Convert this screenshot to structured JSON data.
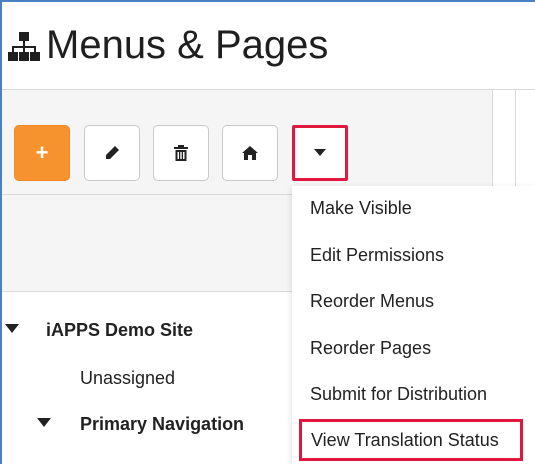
{
  "header": {
    "title": "Menus & Pages",
    "icon": "sitemap-icon"
  },
  "toolbar": {
    "add_label": "+",
    "buttons": [
      {
        "name": "add-button",
        "icon": "plus-icon",
        "color": "#f7932f"
      },
      {
        "name": "edit-button",
        "icon": "pencil-icon"
      },
      {
        "name": "delete-button",
        "icon": "trash-icon"
      },
      {
        "name": "home-button",
        "icon": "home-icon"
      },
      {
        "name": "more-actions-dropdown-button",
        "icon": "caret-down-icon",
        "highlight": "#e0173e"
      }
    ]
  },
  "dropdown": {
    "items": [
      {
        "label": "Make Visible"
      },
      {
        "label": "Edit Permissions"
      },
      {
        "label": "Reorder Menus"
      },
      {
        "label": "Reorder Pages"
      },
      {
        "label": "Submit for Distribution"
      },
      {
        "label": "View Translation Status",
        "highlighted": true
      }
    ]
  },
  "tree": {
    "site": "iAPPS Demo Site",
    "unassigned": "Unassigned",
    "primary_navigation": "Primary Navigation"
  },
  "colors": {
    "accent": "#f7932f",
    "highlight": "#e0173e",
    "frame": "#4a7fc1"
  }
}
